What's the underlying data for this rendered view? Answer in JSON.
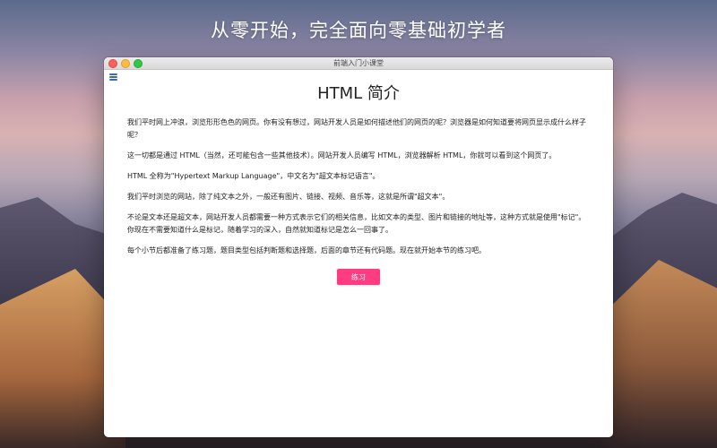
{
  "desktop": {
    "headline": "从零开始，完全面向零基础初学者"
  },
  "window": {
    "title": "前端入门小课堂",
    "menu_icon": "hamburger-menu-icon"
  },
  "page": {
    "title": "HTML 简介",
    "paragraphs": [
      "我们平时网上冲浪，浏览形形色色的网页。你有没有想过，网站开发人员是如何描述他们的网页的呢？浏览器是如何知道要将网页显示成什么样子呢？",
      "这一切都是通过 HTML（当然，还可能包含一些其他技术）。网站开发人员编写 HTML，浏览器解析 HTML，你就可以看到这个网页了。",
      "HTML 全称为\"Hypertext Markup Language\"，中文名为\"超文本标记语言\"。",
      "我们平时浏览的网站，除了纯文本之外，一般还有图片、链接、视频、音乐等，这就是所谓\"超文本\"。",
      "不论是文本还是超文本，网站开发人员都需要一种方式表示它们的相关信息，比如文本的类型、图片和链接的地址等，这种方式就是使用\"标记\"。你现在不需要知道什么是标记，随着学习的深入，自然就知道标记是怎么一回事了。",
      "每个小节后都准备了练习题，题目类型包括判断题和选择题，后面的章节还有代码题。现在就开始本节的练习吧。"
    ],
    "practice_button": "练习"
  },
  "colors": {
    "accent_button": "#ff3b82",
    "menu_icon": "#3d6d9e"
  }
}
